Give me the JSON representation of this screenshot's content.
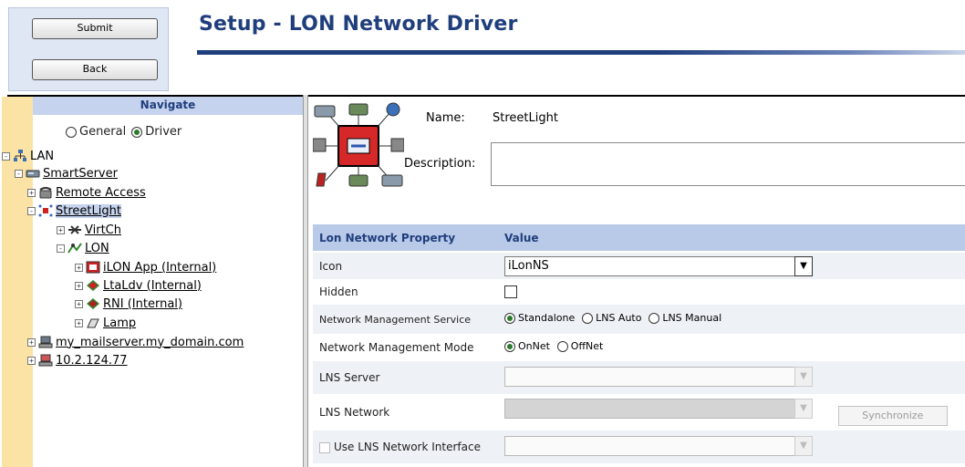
{
  "header": {
    "submit_label": "Submit",
    "back_label": "Back",
    "title": "Setup - LON Network Driver"
  },
  "nav": {
    "title": "Navigate",
    "radio_general": "General",
    "radio_driver": "Driver",
    "selected_radio": "Driver",
    "tree": [
      {
        "label": "LAN",
        "level": 0,
        "expander": "-",
        "icon": "network-icon",
        "link": false
      },
      {
        "label": "SmartServer",
        "level": 1,
        "expander": "-",
        "icon": "server-icon",
        "link": true
      },
      {
        "label": "Remote Access",
        "level": 2,
        "expander": "+",
        "icon": "phone-icon",
        "link": true
      },
      {
        "label": "StreetLight",
        "level": 2,
        "expander": "-",
        "icon": "lon-network-icon",
        "link": true,
        "selected": true
      },
      {
        "label": "VirtCh",
        "level": 3,
        "expander": "+",
        "icon": "virtual-channel-icon",
        "link": true
      },
      {
        "label": "LON",
        "level": 3,
        "expander": "-",
        "icon": "lon-channel-icon",
        "link": true
      },
      {
        "label": "iLON App (Internal)",
        "level": 4,
        "expander": "+",
        "icon": "app-icon",
        "link": true
      },
      {
        "label": "LtaLdv (Internal)",
        "level": 4,
        "expander": "+",
        "icon": "device-icon",
        "link": true
      },
      {
        "label": "RNI (Internal)",
        "level": 4,
        "expander": "+",
        "icon": "rni-icon",
        "link": true
      },
      {
        "label": "Lamp",
        "level": 4,
        "expander": "+",
        "icon": "lamp-icon",
        "link": true
      },
      {
        "label": "my_mailserver.my_domain.com",
        "level": 1,
        "expander": "+",
        "icon": "mail-server-icon",
        "link": true
      },
      {
        "label": "10.2.124.77",
        "level": 1,
        "expander": "+",
        "icon": "remote-server-icon",
        "link": true
      }
    ]
  },
  "details": {
    "name_label": "Name:",
    "name_value": "StreetLight",
    "description_label": "Description:",
    "description_value": ""
  },
  "table": {
    "col_property": "Lon Network Property",
    "col_value": "Value",
    "rows": {
      "icon": {
        "label": "Icon",
        "value": "iLonNS"
      },
      "hidden": {
        "label": "Hidden",
        "checked": false
      },
      "nm_service": {
        "label": "Network Management Service",
        "opt1": "Standalone",
        "opt2": "LNS Auto",
        "opt3": "LNS Manual",
        "selected": "Standalone"
      },
      "nm_mode": {
        "label": "Network Management Mode",
        "opt1": "OnNet",
        "opt2": "OffNet",
        "selected": "OnNet"
      },
      "lns_server": {
        "label": "LNS Server",
        "value": ""
      },
      "lns_network": {
        "label": "LNS Network",
        "value": "",
        "sync_label": "Synchronize"
      },
      "use_lns_iface": {
        "label": "Use LNS Network Interface",
        "checked": false,
        "value": ""
      }
    }
  },
  "colors": {
    "title_blue": "#1f3e7c",
    "header_bg": "#b9c9e8",
    "left_strip": "#fbe3a5"
  }
}
